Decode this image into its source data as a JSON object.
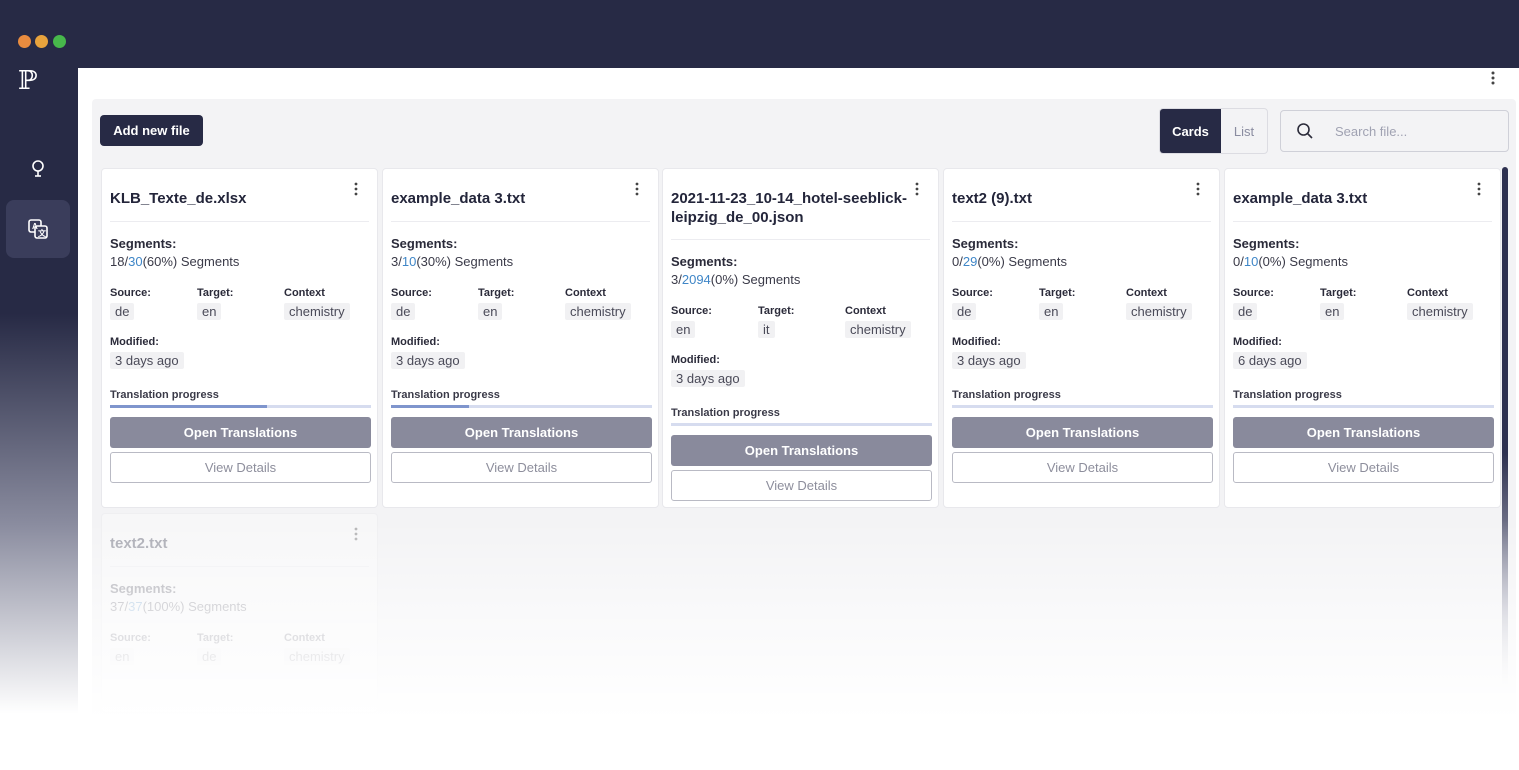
{
  "window": {
    "dot_colors": [
      "#e98c3f",
      "#e8a33d",
      "#47b84b"
    ]
  },
  "sidebar": {
    "logo_text": "ℙ",
    "items": [
      {
        "icon": "lightbulb-icon"
      },
      {
        "icon": "translate-icon",
        "active": true
      }
    ]
  },
  "toolbar": {
    "add_file_label": "Add new file",
    "view_options": [
      "Cards",
      "List"
    ],
    "selected_view": "Cards",
    "search_placeholder": "Search file..."
  },
  "labels": {
    "segments": "Segments:",
    "segments_suffix": "Segments",
    "source": "Source:",
    "target": "Target:",
    "context": "Context",
    "modified": "Modified:",
    "translation_progress": "Translation progress",
    "open_translations": "Open Translations",
    "view_details": "View Details"
  },
  "files": [
    {
      "name": "KLB_Texte_de.xlsx",
      "done": "18",
      "total": "30",
      "pct": "(60%)",
      "source": "de",
      "target": "en",
      "context": "chemistry",
      "modified": "3 days ago",
      "progress": 0.6
    },
    {
      "name": "example_data 3.txt",
      "done": "3",
      "total": "10",
      "pct": "(30%)",
      "source": "de",
      "target": "en",
      "context": "chemistry",
      "modified": "3 days ago",
      "progress": 0.3
    },
    {
      "name": "2021-11-23_10-14_hotel-seeblick-leipzig_de_00.json",
      "done": "3",
      "total": "2094",
      "pct": "(0%)",
      "source": "en",
      "target": "it",
      "context": "chemistry",
      "modified": "3 days ago",
      "progress": 0
    },
    {
      "name": "text2 (9).txt",
      "done": "0",
      "total": "29",
      "pct": "(0%)",
      "source": "de",
      "target": "en",
      "context": "chemistry",
      "modified": "3 days ago",
      "progress": 0
    },
    {
      "name": "example_data 3.txt",
      "done": "0",
      "total": "10",
      "pct": "(0%)",
      "source": "de",
      "target": "en",
      "context": "chemistry",
      "modified": "6 days ago",
      "progress": 0
    },
    {
      "name": "text2.txt",
      "done": "37",
      "total": "37",
      "pct": "(100%)",
      "source": "en",
      "target": "de",
      "context": "chemistry",
      "modified": "",
      "progress": 1
    }
  ]
}
